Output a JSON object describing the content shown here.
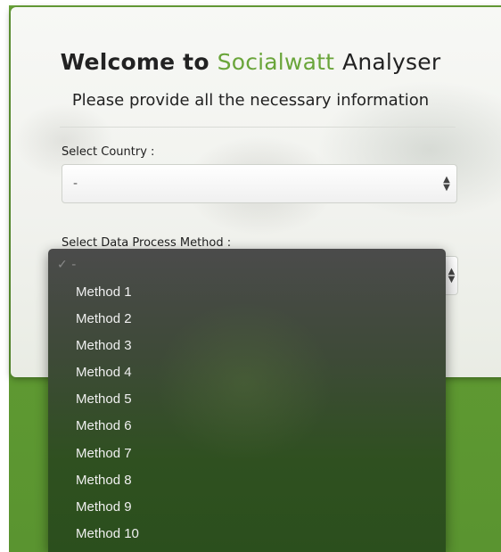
{
  "header": {
    "title_prefix": "Welcome to",
    "title_brand": "Socialwatt",
    "title_suffix": "Analyser",
    "subtitle": "Please provide all the necessary information"
  },
  "form": {
    "country_label": "Select Country :",
    "country_value": "-",
    "method_label": "Select Data Process Method :"
  },
  "dropdown": {
    "selected_mark": "✓",
    "selected_value": "-",
    "options": [
      "Method 1",
      "Method 2",
      "Method 3",
      "Method 4",
      "Method 5",
      "Method 6",
      "Method 7",
      "Method 8",
      "Method 9",
      "Method 10"
    ]
  },
  "icons": {
    "select_arrows": "updown-arrows-icon",
    "check": "check-icon"
  },
  "colors": {
    "brand": "#6aa53a",
    "background": "#5f9a32"
  }
}
